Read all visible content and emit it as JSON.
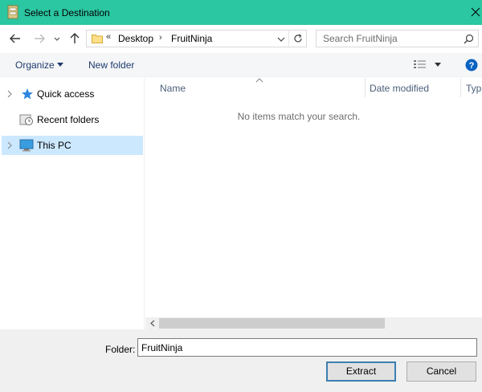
{
  "window": {
    "title": "Select a Destination"
  },
  "address": {
    "overflow": "«",
    "crumbs": [
      "Desktop",
      "FruitNinja"
    ]
  },
  "search": {
    "placeholder": "Search FruitNinja"
  },
  "toolbar": {
    "organize": "Organize",
    "new_folder": "New folder"
  },
  "sidebar": {
    "items": [
      {
        "label": "Quick access",
        "icon": "star-icon"
      },
      {
        "label": "Recent folders",
        "icon": "recent-folders-icon"
      },
      {
        "label": "This PC",
        "icon": "computer-icon",
        "selected": true
      }
    ]
  },
  "columns": [
    "Name",
    "Date modified",
    "Typ"
  ],
  "empty_message": "No items match your search.",
  "footer": {
    "folder_label": "Folder:",
    "folder_value": "FruitNinja",
    "extract_label": "Extract",
    "cancel_label": "Cancel"
  },
  "colors": {
    "titlebar": "#2bc6a2",
    "selection": "#cce8ff",
    "help": "#0a62c2"
  }
}
